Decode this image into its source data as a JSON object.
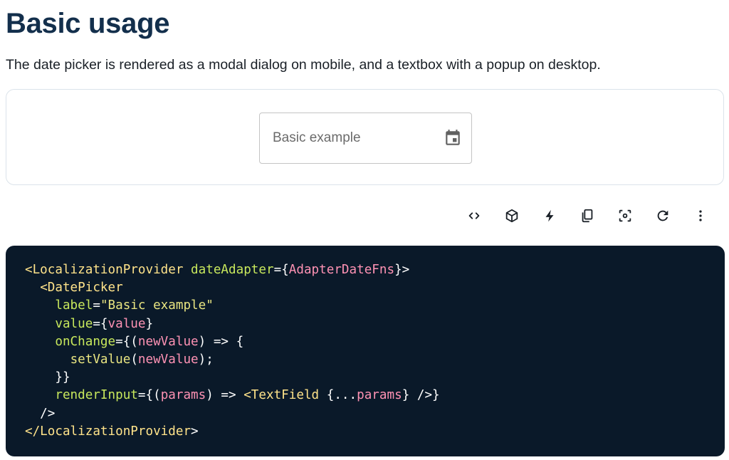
{
  "page": {
    "title": "Basic usage",
    "description": "The date picker is rendered as a modal dialog on mobile, and a textbox with a popup on desktop."
  },
  "demo": {
    "field_placeholder": "Basic example",
    "field_value": "",
    "calendar_icon": "calendar-event-icon"
  },
  "toolbar": {
    "icons": [
      "code-icon",
      "cube-icon",
      "bolt-icon",
      "copy-icon",
      "screenshot-icon",
      "refresh-icon",
      "more-vert-icon"
    ]
  },
  "code_lines": [
    [
      {
        "t": "<LocalizationProvider",
        "c": "tag"
      },
      {
        "t": " ",
        "c": "pun"
      },
      {
        "t": "dateAdapter",
        "c": "attr"
      },
      {
        "t": "={",
        "c": "pun"
      },
      {
        "t": "AdapterDateFns",
        "c": "var"
      },
      {
        "t": "}>",
        "c": "pun"
      }
    ],
    [
      {
        "t": "  ",
        "c": "pun"
      },
      {
        "t": "<DatePicker",
        "c": "tag"
      }
    ],
    [
      {
        "t": "    ",
        "c": "pun"
      },
      {
        "t": "label",
        "c": "attr"
      },
      {
        "t": "=",
        "c": "pun"
      },
      {
        "t": "\"Basic example\"",
        "c": "str"
      }
    ],
    [
      {
        "t": "    ",
        "c": "pun"
      },
      {
        "t": "value",
        "c": "attr"
      },
      {
        "t": "={",
        "c": "pun"
      },
      {
        "t": "value",
        "c": "var"
      },
      {
        "t": "}",
        "c": "pun"
      }
    ],
    [
      {
        "t": "    ",
        "c": "pun"
      },
      {
        "t": "onChange",
        "c": "attr"
      },
      {
        "t": "={(",
        "c": "pun"
      },
      {
        "t": "newValue",
        "c": "var"
      },
      {
        "t": ") => {",
        "c": "pun"
      }
    ],
    [
      {
        "t": "      ",
        "c": "pun"
      },
      {
        "t": "setValue",
        "c": "str"
      },
      {
        "t": "(",
        "c": "pun"
      },
      {
        "t": "newValue",
        "c": "var"
      },
      {
        "t": ");",
        "c": "pun"
      }
    ],
    [
      {
        "t": "    }}",
        "c": "pun"
      }
    ],
    [
      {
        "t": "    ",
        "c": "pun"
      },
      {
        "t": "renderInput",
        "c": "attr"
      },
      {
        "t": "={(",
        "c": "pun"
      },
      {
        "t": "params",
        "c": "var"
      },
      {
        "t": ") => ",
        "c": "pun"
      },
      {
        "t": "<TextField",
        "c": "tag"
      },
      {
        "t": " {...",
        "c": "pun"
      },
      {
        "t": "params",
        "c": "var"
      },
      {
        "t": "} />}",
        "c": "pun"
      }
    ],
    [
      {
        "t": "  />",
        "c": "pun"
      }
    ],
    [
      {
        "t": "</LocalizationProvider",
        "c": "tag"
      },
      {
        "t": ">",
        "c": "pun"
      }
    ]
  ]
}
